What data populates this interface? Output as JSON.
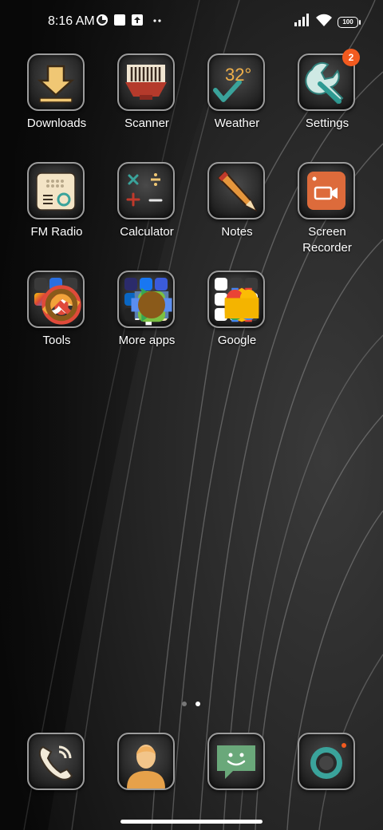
{
  "status_bar": {
    "time": "8:16 AM",
    "battery": "100",
    "icons": [
      "data-saver-icon",
      "square-notification-icon",
      "upload-arrow-icon",
      "more-dots-icon",
      "signal-icon",
      "wifi-icon",
      "battery-icon"
    ]
  },
  "apps": [
    {
      "label": "Downloads",
      "icon": "download-arrow-icon"
    },
    {
      "label": "Scanner",
      "icon": "barcode-scanner-icon"
    },
    {
      "label": "Weather",
      "icon": "weather-temperature-icon",
      "temp": "32°"
    },
    {
      "label": "Settings",
      "icon": "wrench-icon",
      "badge": "2"
    },
    {
      "label": "FM Radio",
      "icon": "radio-icon"
    },
    {
      "label": "Calculator",
      "icon": "calculator-symbols-icon"
    },
    {
      "label": "Notes",
      "icon": "pencil-icon"
    },
    {
      "label": "Screen\nRecorder",
      "line1": "Screen",
      "line2": "Recorder",
      "icon": "video-camera-icon"
    }
  ],
  "folders": [
    {
      "label": "Tools"
    },
    {
      "label": "More apps"
    },
    {
      "label": "Google"
    }
  ],
  "dock": [
    {
      "name": "phone",
      "icon": "phone-icon"
    },
    {
      "name": "contacts",
      "icon": "contact-person-icon"
    },
    {
      "name": "messages",
      "icon": "message-smile-icon"
    },
    {
      "name": "camera",
      "icon": "camera-lens-icon"
    }
  ],
  "pages": {
    "count": 2,
    "current": 2
  },
  "colors": {
    "badge": "#f25a1f",
    "tile_border": "#9c9c9c",
    "background": "#1b1b1b"
  }
}
